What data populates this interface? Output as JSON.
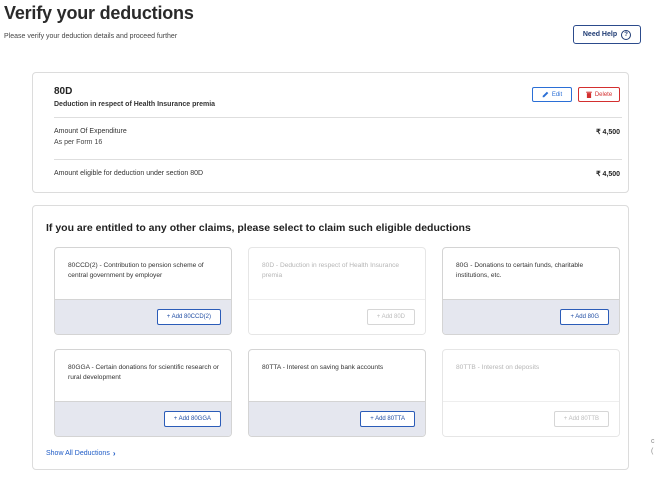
{
  "page": {
    "title": "Verify your deductions",
    "subtitle": "Please verify your deduction details and proceed further",
    "need_help_label": "Need Help",
    "help_glyph": "?"
  },
  "section_80d": {
    "code": "80D",
    "description": "Deduction in respect of Health Insurance premia",
    "edit_label": "Edit",
    "delete_label": "Delete",
    "rows": [
      {
        "label": "Amount Of Expenditure",
        "sub": "As per Form 16",
        "amount": "₹ 4,500"
      },
      {
        "label": "Amount eligible for deduction under section 80D",
        "amount": "₹ 4,500"
      }
    ],
    "colors": {
      "edit": "#2b6fd6",
      "delete": "#d32f2f"
    }
  },
  "claims": {
    "title": "If you are entitled to any other claims, please select to claim such eligible deductions",
    "cards": [
      {
        "text": "80CCD(2) - Contribution to pension scheme of central government by employer",
        "button": "+ Add 80CCD(2)",
        "enabled": true
      },
      {
        "text": "80D - Deduction in respect of Health Insurance premia",
        "button": "+ Add 80D",
        "enabled": false
      },
      {
        "text": "80G - Donations to certain funds, charitable institutions, etc.",
        "button": "+ Add 80G",
        "enabled": true
      },
      {
        "text": "80GGA - Certain donations for scientific research or rural development",
        "button": "+ Add 80GGA",
        "enabled": true
      },
      {
        "text": "80TTA - Interest on saving bank accounts",
        "button": "+ Add 80TTA",
        "enabled": true
      },
      {
        "text": "80TTB - Interest on deposits",
        "button": "+ Add 80TTB",
        "enabled": false
      }
    ],
    "show_all_label": "Show All Deductions",
    "show_all_chevron": "›"
  },
  "edge_marks": [
    "c",
    "("
  ],
  "icons": {
    "edit": "pencil-icon",
    "delete": "trash-icon",
    "help": "question-circle-icon",
    "chevron": "chevron-right-icon"
  }
}
